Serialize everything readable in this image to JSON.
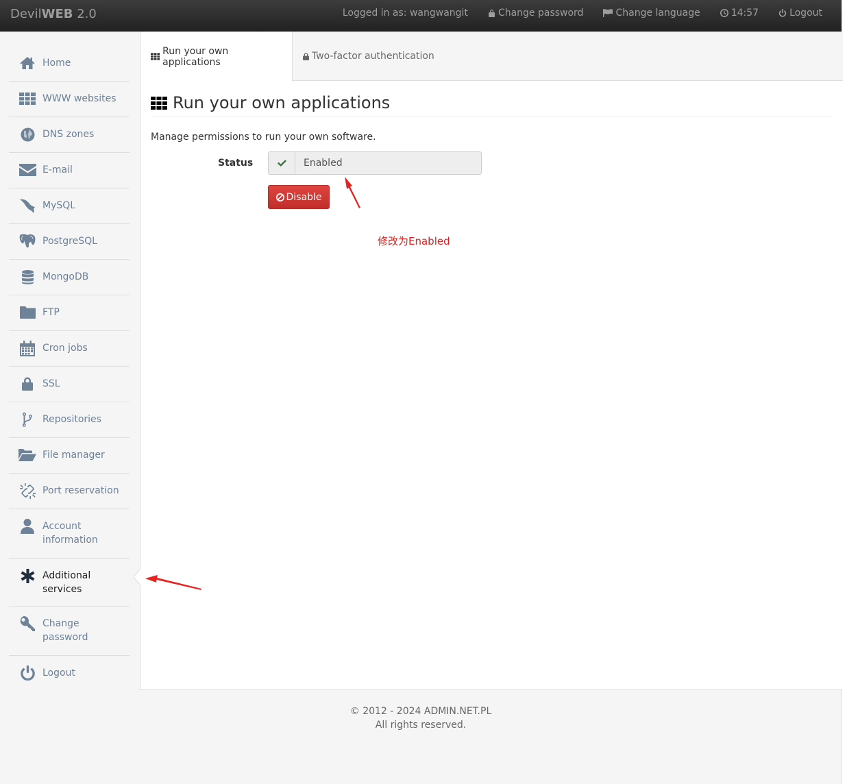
{
  "navbar": {
    "brand_light": "Devil",
    "brand_bold": "WEB",
    "brand_version": "2.0",
    "logged_in": "Logged in as: wangwangit",
    "change_password": "Change password",
    "change_language": "Change language",
    "time": "14:57",
    "logout": "Logout"
  },
  "sidebar": {
    "items": [
      {
        "label": "Home",
        "icon": "home-icon"
      },
      {
        "label": "WWW websites",
        "icon": "grid-icon"
      },
      {
        "label": "DNS zones",
        "icon": "globe-icon"
      },
      {
        "label": "E-mail",
        "icon": "envelope-icon"
      },
      {
        "label": "MySQL",
        "icon": "dolphin-icon"
      },
      {
        "label": "PostgreSQL",
        "icon": "elephant-icon"
      },
      {
        "label": "MongoDB",
        "icon": "database-icon"
      },
      {
        "label": "FTP",
        "icon": "folder-icon"
      },
      {
        "label": "Cron jobs",
        "icon": "calendar-icon"
      },
      {
        "label": "SSL",
        "icon": "lock-icon"
      },
      {
        "label": "Repositories",
        "icon": "branch-icon"
      },
      {
        "label": "File manager",
        "icon": "folder-open-icon"
      },
      {
        "label": "Port reservation",
        "icon": "unlink-icon"
      },
      {
        "label": "Account information",
        "icon": "user-icon"
      },
      {
        "label": "Additional services",
        "icon": "asterisk-icon"
      },
      {
        "label": "Change password",
        "icon": "key-icon"
      },
      {
        "label": "Logout",
        "icon": "power-icon"
      }
    ]
  },
  "tabs": {
    "run_apps": "Run your own applications",
    "two_factor": "Two-factor authentication"
  },
  "main": {
    "title": "Run your own applications",
    "description": "Manage permissions to run your own software.",
    "status_label": "Status",
    "status_value": "Enabled",
    "disable_button": "Disable",
    "annotation": "修改为Enabled"
  },
  "footer": {
    "line1": "© 2012 - 2024 ADMIN.NET.PL",
    "line2": "All rights reserved."
  },
  "colors": {
    "navbar": "#2b2b2b",
    "sidebar_text": "#6c8196",
    "disable_button": "#d9534f",
    "annotation": "#e0201e",
    "check": "#3c763d"
  }
}
